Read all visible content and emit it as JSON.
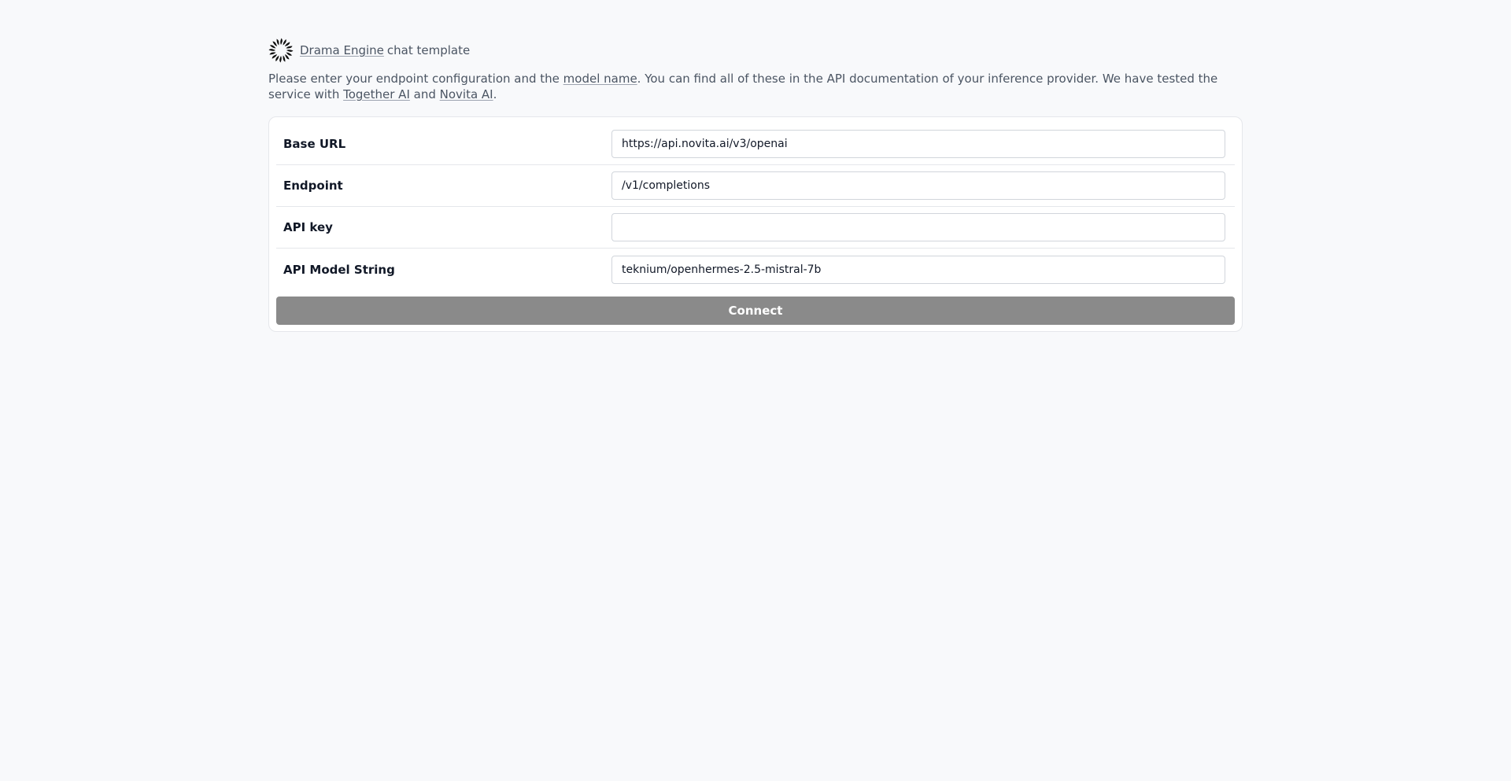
{
  "header": {
    "logo_icon": "sunburst-logo-icon",
    "brand_link": "Drama Engine",
    "suffix": "chat template"
  },
  "intro": {
    "text_1": "Please enter your endpoint configuration and the ",
    "model_name_link": "model name",
    "text_2": ". You can find all of these in the API documentation of your inference provider. We have tested the service with ",
    "together_link": "Together AI",
    "text_3": " and ",
    "novita_link": "Novita AI",
    "text_4": "."
  },
  "form": {
    "base_url": {
      "label": "Base URL",
      "value": "https://api.novita.ai/v3/openai"
    },
    "endpoint": {
      "label": "Endpoint",
      "value": "/v1/completions"
    },
    "api_key": {
      "label": "API key",
      "value": ""
    },
    "model_string": {
      "label": "API Model String",
      "value": "teknium/openhermes-2.5-mistral-7b"
    },
    "connect_label": "Connect"
  },
  "colors": {
    "background": "#f8f9fb",
    "button": "#8a8a8a",
    "card": "#ffffff"
  }
}
